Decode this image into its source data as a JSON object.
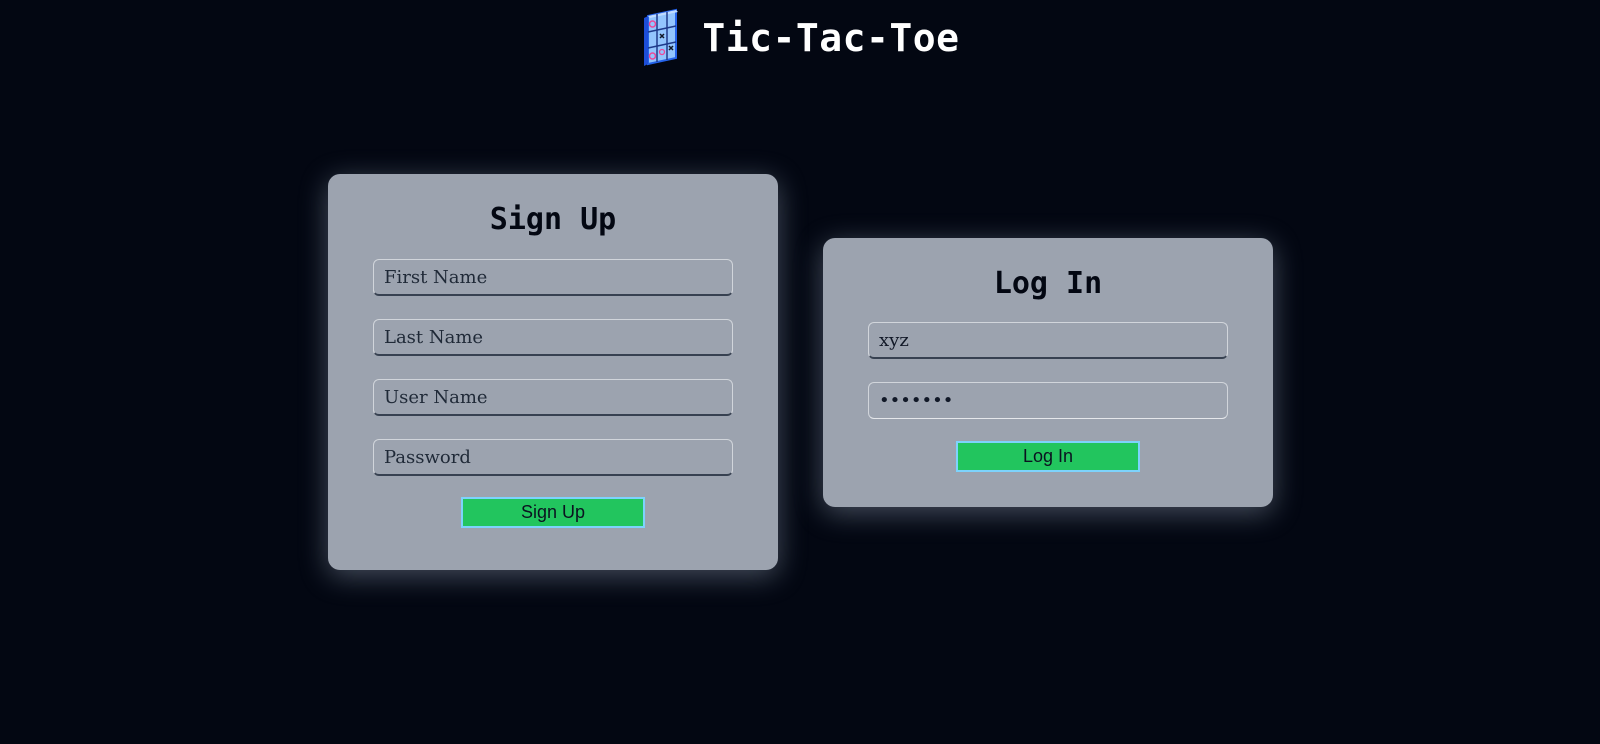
{
  "header": {
    "title": "Tic-Tac-Toe",
    "logo_icon": "tic-tac-toe-grid-icon"
  },
  "signup": {
    "title": "Sign Up",
    "first_name_placeholder": "First Name",
    "last_name_placeholder": "Last Name",
    "user_name_placeholder": "User Name",
    "password_placeholder": "Password",
    "button_label": "Sign Up"
  },
  "login": {
    "title": "Log In",
    "username_value": "xyz",
    "password_value": "•••••••",
    "button_label": "Log In"
  },
  "colors": {
    "background": "#030712",
    "card": "#9ca3af",
    "button": "#22c55e",
    "button_border": "#7dd3fc"
  }
}
